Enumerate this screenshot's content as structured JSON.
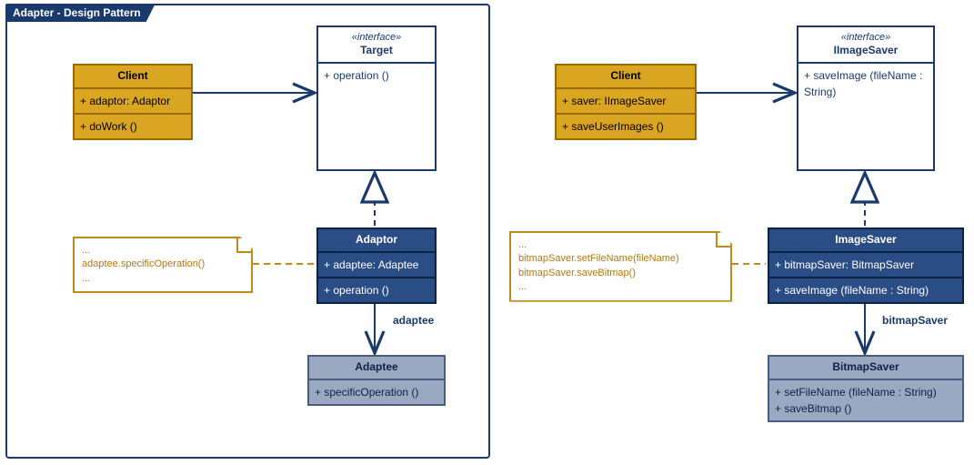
{
  "frame": {
    "title": "Adapter - Design Pattern"
  },
  "left": {
    "client": {
      "name": "Client",
      "attr": "+ adaptor: Adaptor",
      "op": "+ doWork ()"
    },
    "target": {
      "stereo": "«interface»",
      "name": "Target",
      "op": "+ operation ()"
    },
    "adaptor": {
      "name": "Adaptor",
      "attr": "+ adaptee: Adaptee",
      "op": "+ operation ()"
    },
    "adaptee": {
      "name": "Adaptee",
      "op": "+ specificOperation ()"
    },
    "note": {
      "l1": "...",
      "l2": "adaptee.specificOperation()",
      "l3": "..."
    },
    "edge_adaptee": "adaptee"
  },
  "right": {
    "client": {
      "name": "Client",
      "attr": "+ saver: IImageSaver",
      "op": "+ saveUserImages ()"
    },
    "target": {
      "stereo": "«interface»",
      "name": "IImageSaver",
      "op": "+ saveImage (fileName : String)"
    },
    "adaptor": {
      "name": "ImageSaver",
      "attr": "+ bitmapSaver: BitmapSaver",
      "op": "+ saveImage (fileName : String)"
    },
    "adaptee": {
      "name": "BitmapSaver",
      "op1": "+ setFileName (fileName : String)",
      "op2": "+ saveBitmap ()"
    },
    "note": {
      "l1": "...",
      "l2": "bitmapSaver.setFileName(fileName)",
      "l3": "bitmapSaver.saveBitmap()",
      "l4": "..."
    },
    "edge_adaptee": "bitmapSaver"
  },
  "chart_data": {
    "type": "table",
    "description": "UML class diagram of the Adapter design pattern — abstract on the left, concrete example on the right.",
    "diagrams": [
      {
        "title": "Adapter - Design Pattern",
        "classes": [
          {
            "name": "Client",
            "attributes": [
              "adaptor: Adaptor"
            ],
            "operations": [
              "doWork()"
            ]
          },
          {
            "name": "Target",
            "stereotype": "interface",
            "operations": [
              "operation()"
            ]
          },
          {
            "name": "Adaptor",
            "attributes": [
              "adaptee: Adaptee"
            ],
            "operations": [
              "operation()"
            ]
          },
          {
            "name": "Adaptee",
            "operations": [
              "specificOperation()"
            ]
          }
        ],
        "relations": [
          {
            "from": "Client",
            "to": "Target",
            "type": "association"
          },
          {
            "from": "Adaptor",
            "to": "Target",
            "type": "realization"
          },
          {
            "from": "Adaptor",
            "to": "Adaptee",
            "type": "association",
            "label": "adaptee"
          }
        ],
        "note": {
          "attachedTo": "Adaptor",
          "body": "adaptee.specificOperation()"
        }
      },
      {
        "title": "Concrete example",
        "classes": [
          {
            "name": "Client",
            "attributes": [
              "saver: IImageSaver"
            ],
            "operations": [
              "saveUserImages()"
            ]
          },
          {
            "name": "IImageSaver",
            "stereotype": "interface",
            "operations": [
              "saveImage(fileName : String)"
            ]
          },
          {
            "name": "ImageSaver",
            "attributes": [
              "bitmapSaver: BitmapSaver"
            ],
            "operations": [
              "saveImage(fileName : String)"
            ]
          },
          {
            "name": "BitmapSaver",
            "operations": [
              "setFileName(fileName : String)",
              "saveBitmap()"
            ]
          }
        ],
        "relations": [
          {
            "from": "Client",
            "to": "IImageSaver",
            "type": "association"
          },
          {
            "from": "ImageSaver",
            "to": "IImageSaver",
            "type": "realization"
          },
          {
            "from": "ImageSaver",
            "to": "BitmapSaver",
            "type": "association",
            "label": "bitmapSaver"
          }
        ],
        "note": {
          "attachedTo": "ImageSaver",
          "body": "bitmapSaver.setFileName(fileName); bitmapSaver.saveBitmap()"
        }
      }
    ]
  }
}
